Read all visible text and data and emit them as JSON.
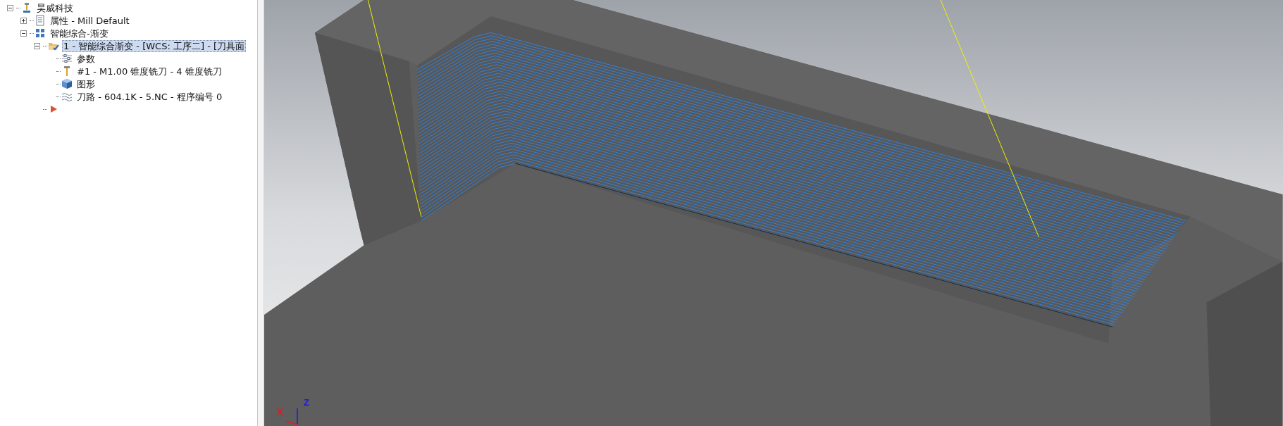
{
  "tree": [
    {
      "label": "昊威科技",
      "expanded": true,
      "selected": false,
      "children": [
        {
          "label": "属性 - Mill Default",
          "expanded": false,
          "selected": false
        },
        {
          "label": "智能综合-渐变",
          "expanded": true,
          "selected": false,
          "children": [
            {
              "label": "1 - 智能综合渐变 - [WCS: 工序二] - [刀具面",
              "expanded": true,
              "selected": true,
              "children": [
                {
                  "label": "参数",
                  "selected": false
                },
                {
                  "label": "#1 - M1.00 锥度铣刀 - 4 锥度铣刀",
                  "selected": false
                },
                {
                  "label": "图形",
                  "selected": false
                },
                {
                  "label": "刀路 - 604.1K - 5.NC - 程序编号 0",
                  "selected": false
                }
              ]
            },
            {
              "kind": "insert-arrow"
            }
          ]
        }
      ]
    }
  ],
  "viewport": {
    "axes": [
      {
        "kind": "z",
        "label": "Z"
      },
      {
        "kind": "x",
        "label": "X"
      }
    ]
  }
}
